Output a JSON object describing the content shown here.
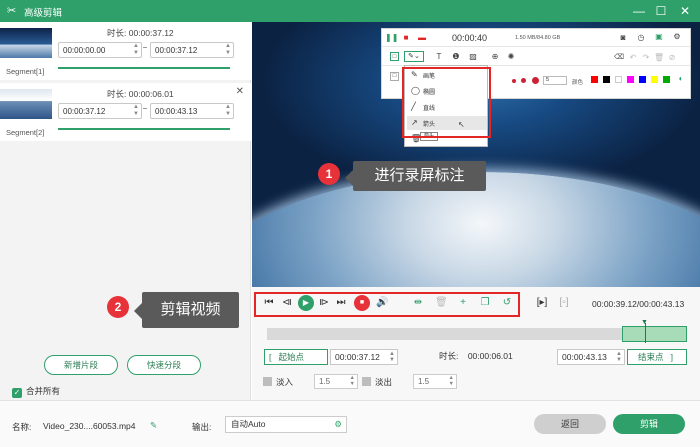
{
  "window": {
    "title": "高级剪辑",
    "logo_icon": "scissors-logo-icon"
  },
  "segments": [
    {
      "label": "Segment[1]",
      "duration_label": "时长:",
      "duration": "00:00:37.12",
      "start": "00:00:00.00",
      "end": "00:00:37.12"
    },
    {
      "label": "Segment[2]",
      "duration_label": "时长:",
      "duration": "00:00:06.01",
      "start": "00:00:37.12",
      "end": "00:00:43.13"
    }
  ],
  "left_buttons": {
    "add_segment": "新增片段",
    "quick_split": "快速分段"
  },
  "merge_all": "合并所有",
  "recording_toolbar": {
    "time": "00:00:40",
    "size": "1.50 MB/84.80 GB",
    "color_label": "颜色",
    "brush_size": "5",
    "dropdown_items": [
      "画笔",
      "椭圆",
      "直线",
      "箭头"
    ],
    "tooltip": "箭头",
    "colors": [
      "#ff0000",
      "#000000",
      "#ffffff",
      "#ff00ff",
      "#0000ff",
      "#ffff00",
      "#00aa00"
    ]
  },
  "callouts": [
    {
      "number": "1",
      "text": "进行录屏标注"
    },
    {
      "number": "2",
      "text": "剪辑视频"
    }
  ],
  "player": {
    "time": "00:00:39.12/00:00:43.13"
  },
  "trim": {
    "start_label": "起始点",
    "start": "00:00:37.12",
    "duration_label": "时长:",
    "duration": "00:00:06.01",
    "end": "00:00:43.13",
    "end_label": "结束点"
  },
  "fade": {
    "in_label": "淡入",
    "in_value": "1.5",
    "out_label": "淡出",
    "out_value": "1.5"
  },
  "bottom": {
    "name_label": "名称:",
    "name_value": "Video_230....60053.mp4",
    "output_label": "输出:",
    "output_value": "自动Auto",
    "back": "返回",
    "edit": "剪辑"
  },
  "colors": {
    "brand": "#2fa06a",
    "highlight": "#e32626"
  }
}
